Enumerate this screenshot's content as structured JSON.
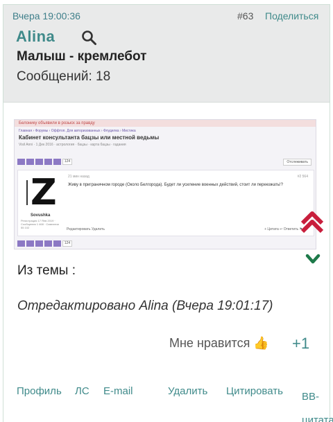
{
  "post": {
    "date": "Вчера 19:00:36",
    "number": "#63",
    "share_label": "Поделиться",
    "author": "Alina",
    "user_title": "Малыш - кремлебот",
    "message_count": "Сообщений: 18"
  },
  "attachment": {
    "banner": "Белонику объявили в розыск за правду",
    "breadcrumbs": "Главная › Форумы › Оффтоп. Для авторизованных › Флудилка › Мистика",
    "title": "Кабинет консультанта бацзы или местной ведьмы",
    "tags": "Visil Anni · 1 Дек 2016 · астрология · бацзы · карта бацзы · гадания",
    "page_current": "124",
    "follow_label": "Отслеживать",
    "post_when": "21 мин назад",
    "post_id": "#2 564",
    "post_body": "Живу в приграничном городе (Около Белгорода). Будет ли усиление военных действий, стоит ли переезжать!?",
    "poster_name": "Sovushka",
    "poster_meta": "Регистрация 17 Янв 2019 · Сообщения 1 468 · Симпатии 55 102",
    "actions_left": "Редактировать  Удалить",
    "actions_right": "+ Цитата  ↩ Ответить  ⚑ Ж"
  },
  "topic_text": "Из темы  :",
  "edited_text": "Отредактировано Alina (Вчера 19:01:17)",
  "like": {
    "label": "Мне нравится 👍",
    "count": "+1"
  },
  "footer": {
    "profile": "Профиль",
    "pm": "ЛС",
    "email": "E-mail",
    "delete": "Удалить",
    "quote": "Цитировать",
    "bb_quote": "BB-цитата"
  },
  "icons": {
    "search": "search-icon",
    "scroll_up": "double-chevron-up-icon",
    "scroll_down": "chevron-down-icon",
    "thumb": "thumbs-up-icon"
  },
  "colors": {
    "accent": "#3f8a8a",
    "header_bg": "#e9eaea",
    "up_arrow": "#c81e3c",
    "down_arrow": "#1e7a4a"
  }
}
